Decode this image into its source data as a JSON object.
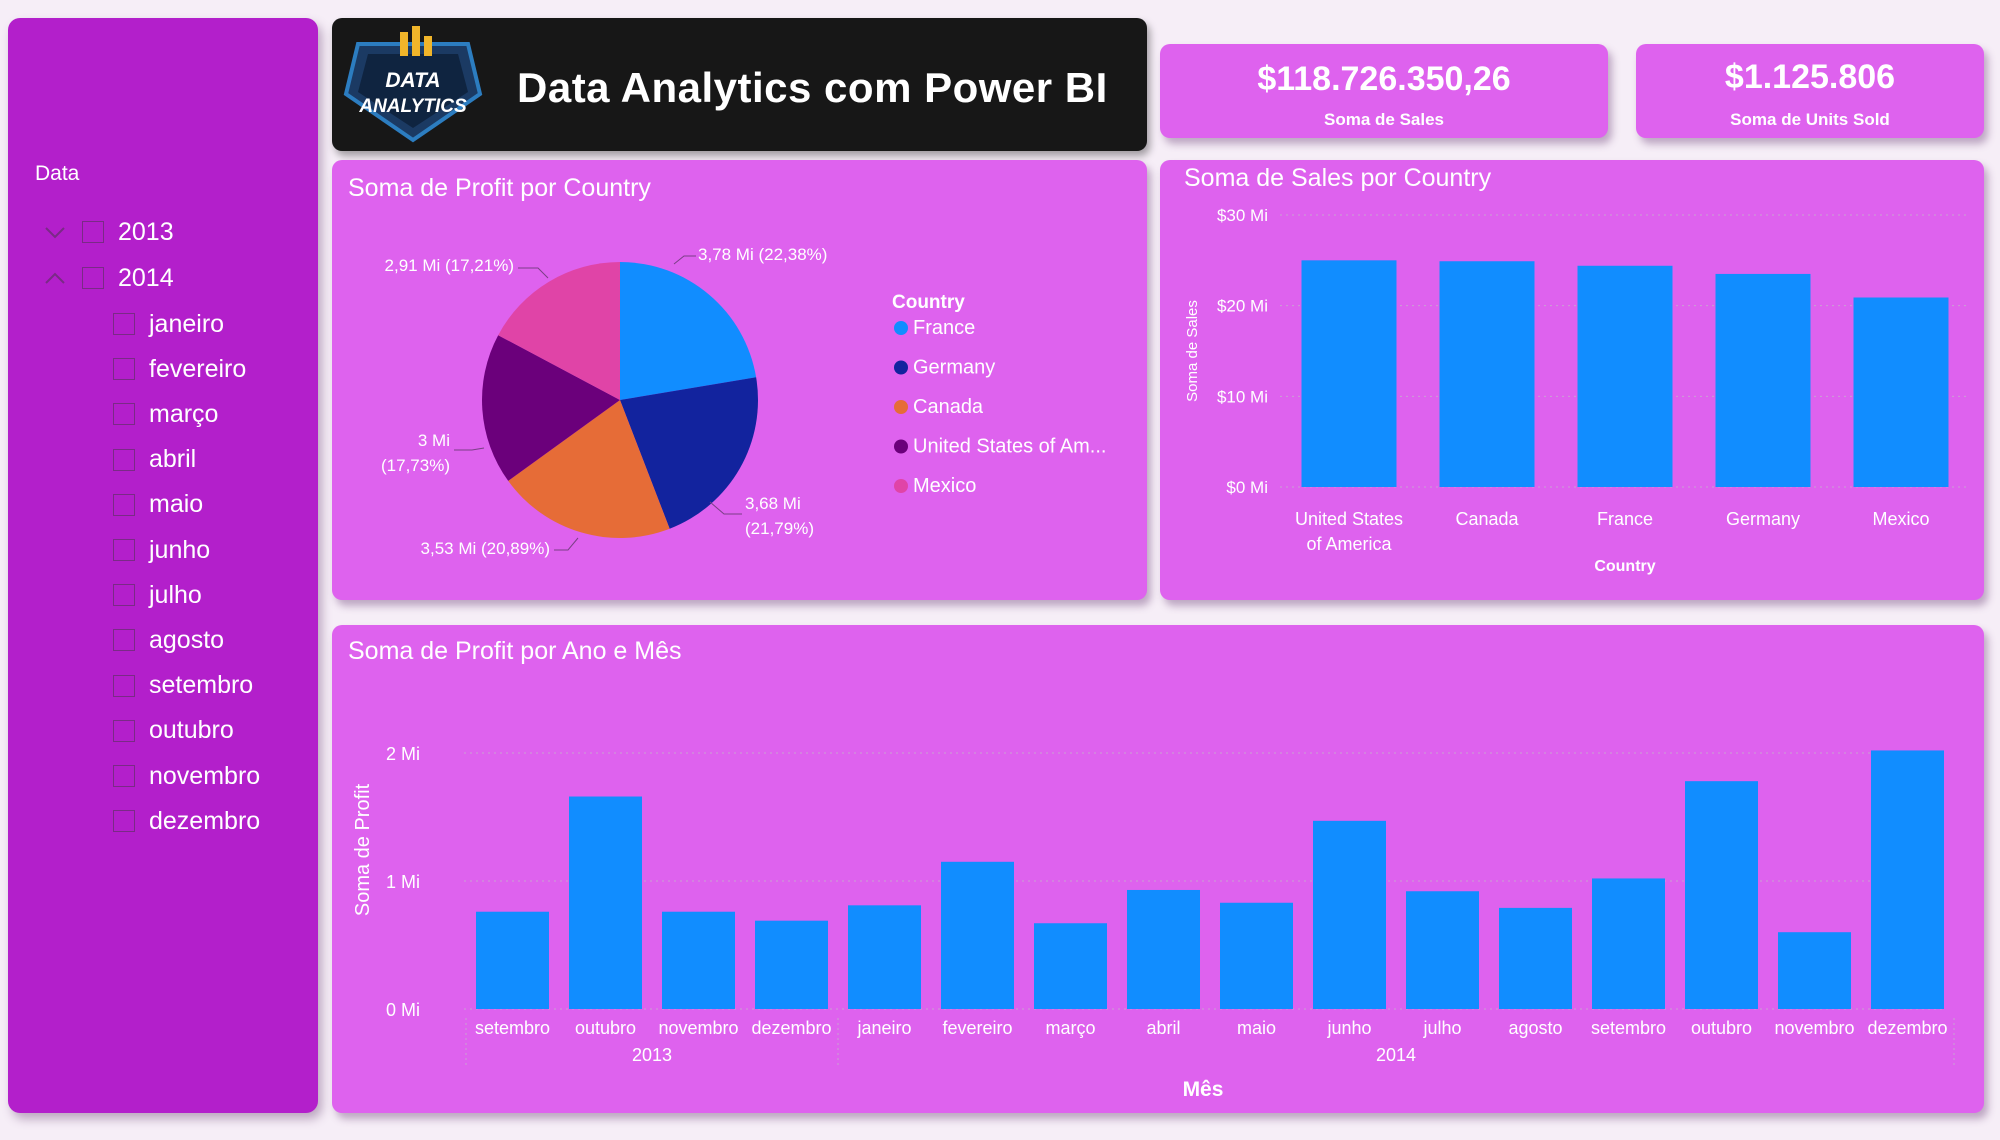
{
  "header": {
    "title": "Data Analytics com Power BI",
    "logo_text_1": "DATA",
    "logo_text_2": "ANALYTICS"
  },
  "kpis": [
    {
      "value": "$118.726.350,26",
      "label": "Soma de  Sales"
    },
    {
      "value": "$1.125.806",
      "label": "Soma de Units Sold"
    }
  ],
  "slicer": {
    "title": "Data",
    "years": [
      {
        "label": "2013",
        "expanded": false
      },
      {
        "label": "2014",
        "expanded": true
      }
    ],
    "months": [
      "janeiro",
      "fevereiro",
      "março",
      "abril",
      "maio",
      "junho",
      "julho",
      "agosto",
      "setembro",
      "outubro",
      "novembro",
      "dezembro"
    ]
  },
  "colors": {
    "sidebar": "#b31fcb",
    "card": "#de62ee",
    "bar": "#118dff",
    "france": "#118dff",
    "germany": "#12239e",
    "canada": "#e66c37",
    "usa": "#6b007b",
    "mexico": "#e044a7"
  },
  "pie": {
    "title": "Soma de Profit por Country",
    "legend_title": "Country",
    "legend": [
      "France",
      "Germany",
      "Canada",
      "United States of Am...",
      "Mexico"
    ],
    "chart_data": {
      "type": "pie",
      "slices": [
        {
          "name": "France",
          "value": 3.78,
          "label": "3,78 Mi (22,38%)"
        },
        {
          "name": "Germany",
          "value": 3.68,
          "label_1": "3,68 Mi",
          "label_2": "(21,79%)"
        },
        {
          "name": "Canada",
          "value": 3.53,
          "label": "3,53 Mi (20,89%)"
        },
        {
          "name": "United States of America",
          "value": 3.0,
          "label_1": "3 Mi",
          "label_2": "(17,73%)"
        },
        {
          "name": "Mexico",
          "value": 2.91,
          "label": "2,91 Mi (17,21%)"
        }
      ]
    }
  },
  "sales_chart": {
    "title": "Soma de Sales por Country",
    "chart_data": {
      "type": "bar",
      "categories": [
        "United States of America",
        "Canada",
        "France",
        "Germany",
        "Mexico"
      ],
      "category_lines": [
        [
          "United States",
          "of America"
        ],
        [
          "Canada"
        ],
        [
          "France"
        ],
        [
          "Germany"
        ],
        [
          "Mexico"
        ]
      ],
      "values": [
        25.0,
        24.9,
        24.4,
        23.5,
        20.9
      ],
      "xlabel": "Country",
      "ylabel": "Soma de Sales",
      "ylim": [
        0,
        30
      ],
      "yticks": [
        {
          "v": 0,
          "t": "$0 Mi"
        },
        {
          "v": 10,
          "t": "$10 Mi"
        },
        {
          "v": 20,
          "t": "$20 Mi"
        },
        {
          "v": 30,
          "t": "$30 Mi"
        }
      ]
    }
  },
  "profit_chart": {
    "title": "Soma de Profit por Ano e Mês",
    "chart_data": {
      "type": "bar",
      "categories": [
        "setembro",
        "outubro",
        "novembro",
        "dezembro",
        "janeiro",
        "fevereiro",
        "março",
        "abril",
        "maio",
        "junho",
        "julho",
        "agosto",
        "setembro",
        "outubro",
        "novembro",
        "dezembro"
      ],
      "groups": [
        {
          "label": "2013",
          "count": 4
        },
        {
          "label": "2014",
          "count": 12
        }
      ],
      "values": [
        0.76,
        1.66,
        0.76,
        0.69,
        0.81,
        1.15,
        0.67,
        0.93,
        0.83,
        1.47,
        0.92,
        0.79,
        1.02,
        1.78,
        0.6,
        2.02
      ],
      "xlabel": "Mês",
      "ylabel": "Soma de Profit",
      "ylim": [
        0,
        2
      ],
      "yticks": [
        {
          "v": 0,
          "t": "0 Mi"
        },
        {
          "v": 1,
          "t": "1 Mi"
        },
        {
          "v": 2,
          "t": "2 Mi"
        }
      ]
    }
  }
}
